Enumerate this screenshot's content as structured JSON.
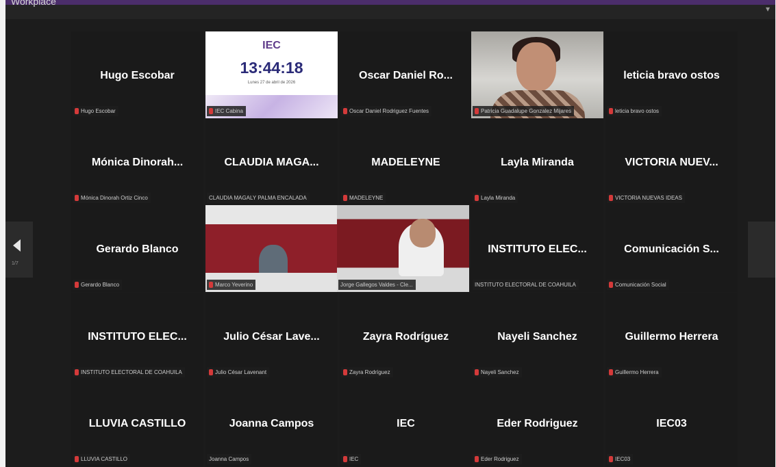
{
  "window": {
    "title": "Workplace"
  },
  "pager": {
    "page": "1/7"
  },
  "tiles": [
    {
      "name": "Hugo Escobar",
      "label": "Hugo Escobar"
    },
    {
      "label": "IEC Cabina",
      "slide": {
        "logo": "IEC",
        "time": "13:44:18",
        "date": "Lunes 27 de abril de 2026"
      }
    },
    {
      "name": "Oscar Daniel Ro...",
      "label": "Oscar Daniel Rodriguez Fuentes"
    },
    {
      "label": "Patricia Guadalupe Gonzalez Mijares"
    },
    {
      "name": "leticia bravo ostos",
      "label": "leticia bravo ostos"
    },
    {
      "name": "Mónica Dinorah...",
      "label": "Mónica Dinorah Ortiz Cinco"
    },
    {
      "name": "CLAUDIA MAGA...",
      "label": "CLAUDIA MAGALY PALMA ENCALADA"
    },
    {
      "name": "MADELEYNE",
      "label": "MADELEYNE"
    },
    {
      "name": "Layla Miranda",
      "label": "Layla Miranda"
    },
    {
      "name": "VICTORIA NUEV...",
      "label": "VICTORIA NUEVAS IDEAS"
    },
    {
      "name": "Gerardo Blanco",
      "label": "Gerardo Blanco"
    },
    {
      "label": "Marco Yeverino"
    },
    {
      "label": "Jorge Gallegos Valdes - Cle..."
    },
    {
      "name": "INSTITUTO ELEC...",
      "label": "INSTITUTO ELECTORAL DE COAHUILA"
    },
    {
      "name": "Comunicación S...",
      "label": "Comunicación Social"
    },
    {
      "name": "INSTITUTO ELEC...",
      "label": "INSTITUTO ELECTORAL DE COAHUILA"
    },
    {
      "name": "Julio César Lave...",
      "label": "Julio César Lavenant"
    },
    {
      "name": "Zayra Rodríguez",
      "label": "Zayra Rodríguez"
    },
    {
      "name": "Nayeli Sanchez",
      "label": "Nayeli Sanchez"
    },
    {
      "name": "Guillermo Herrera",
      "label": "Guillermo Herrera"
    },
    {
      "name": "LLUVIA CASTILLO",
      "label": "LLUVIA CASTILLO"
    },
    {
      "name": "Joanna Campos",
      "label": "Joanna Campos"
    },
    {
      "name": "IEC",
      "label": "IEC"
    },
    {
      "name": "Eder Rodriguez",
      "label": "Eder Rodriguez"
    },
    {
      "name": "IEC03",
      "label": "IEC03"
    }
  ]
}
